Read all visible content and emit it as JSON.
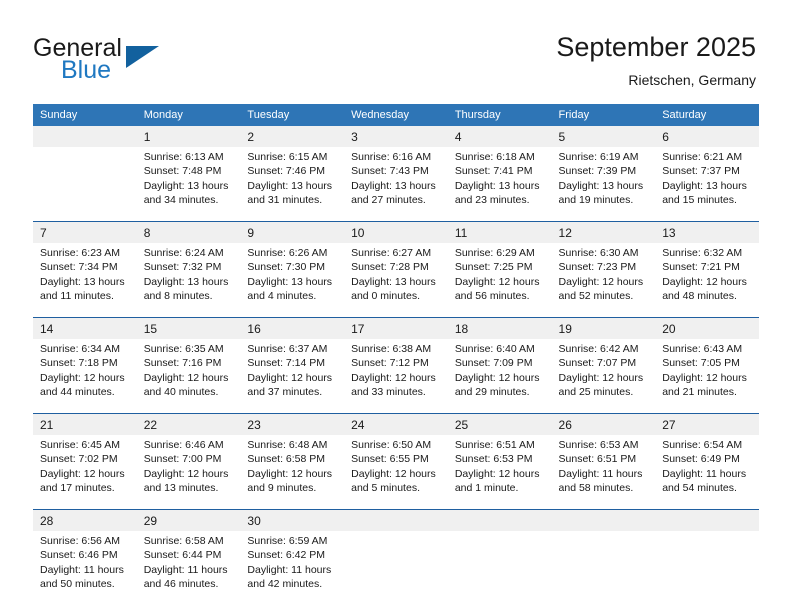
{
  "brand": {
    "word_one": "General",
    "word_two": "Blue",
    "triangle_icon": "triangle-icon",
    "accent_color": "#1f78c1",
    "triangle_color": "#12619e"
  },
  "header": {
    "title": "September 2025",
    "subtitle": "Rietschen, Germany"
  },
  "theme": {
    "header_bg": "#2e75b6",
    "header_text": "#ffffff",
    "daynum_bg": "#f0f0f0",
    "separator": "#1f5fa0"
  },
  "calendar": {
    "weekday_headers": [
      "Sunday",
      "Monday",
      "Tuesday",
      "Wednesday",
      "Thursday",
      "Friday",
      "Saturday"
    ],
    "weeks": [
      {
        "days": [
          {
            "num": "",
            "lines": []
          },
          {
            "num": "1",
            "lines": [
              "Sunrise: 6:13 AM",
              "Sunset: 7:48 PM",
              "Daylight: 13 hours",
              "and 34 minutes."
            ]
          },
          {
            "num": "2",
            "lines": [
              "Sunrise: 6:15 AM",
              "Sunset: 7:46 PM",
              "Daylight: 13 hours",
              "and 31 minutes."
            ]
          },
          {
            "num": "3",
            "lines": [
              "Sunrise: 6:16 AM",
              "Sunset: 7:43 PM",
              "Daylight: 13 hours",
              "and 27 minutes."
            ]
          },
          {
            "num": "4",
            "lines": [
              "Sunrise: 6:18 AM",
              "Sunset: 7:41 PM",
              "Daylight: 13 hours",
              "and 23 minutes."
            ]
          },
          {
            "num": "5",
            "lines": [
              "Sunrise: 6:19 AM",
              "Sunset: 7:39 PM",
              "Daylight: 13 hours",
              "and 19 minutes."
            ]
          },
          {
            "num": "6",
            "lines": [
              "Sunrise: 6:21 AM",
              "Sunset: 7:37 PM",
              "Daylight: 13 hours",
              "and 15 minutes."
            ]
          }
        ]
      },
      {
        "days": [
          {
            "num": "7",
            "lines": [
              "Sunrise: 6:23 AM",
              "Sunset: 7:34 PM",
              "Daylight: 13 hours",
              "and 11 minutes."
            ]
          },
          {
            "num": "8",
            "lines": [
              "Sunrise: 6:24 AM",
              "Sunset: 7:32 PM",
              "Daylight: 13 hours",
              "and 8 minutes."
            ]
          },
          {
            "num": "9",
            "lines": [
              "Sunrise: 6:26 AM",
              "Sunset: 7:30 PM",
              "Daylight: 13 hours",
              "and 4 minutes."
            ]
          },
          {
            "num": "10",
            "lines": [
              "Sunrise: 6:27 AM",
              "Sunset: 7:28 PM",
              "Daylight: 13 hours",
              "and 0 minutes."
            ]
          },
          {
            "num": "11",
            "lines": [
              "Sunrise: 6:29 AM",
              "Sunset: 7:25 PM",
              "Daylight: 12 hours",
              "and 56 minutes."
            ]
          },
          {
            "num": "12",
            "lines": [
              "Sunrise: 6:30 AM",
              "Sunset: 7:23 PM",
              "Daylight: 12 hours",
              "and 52 minutes."
            ]
          },
          {
            "num": "13",
            "lines": [
              "Sunrise: 6:32 AM",
              "Sunset: 7:21 PM",
              "Daylight: 12 hours",
              "and 48 minutes."
            ]
          }
        ]
      },
      {
        "days": [
          {
            "num": "14",
            "lines": [
              "Sunrise: 6:34 AM",
              "Sunset: 7:18 PM",
              "Daylight: 12 hours",
              "and 44 minutes."
            ]
          },
          {
            "num": "15",
            "lines": [
              "Sunrise: 6:35 AM",
              "Sunset: 7:16 PM",
              "Daylight: 12 hours",
              "and 40 minutes."
            ]
          },
          {
            "num": "16",
            "lines": [
              "Sunrise: 6:37 AM",
              "Sunset: 7:14 PM",
              "Daylight: 12 hours",
              "and 37 minutes."
            ]
          },
          {
            "num": "17",
            "lines": [
              "Sunrise: 6:38 AM",
              "Sunset: 7:12 PM",
              "Daylight: 12 hours",
              "and 33 minutes."
            ]
          },
          {
            "num": "18",
            "lines": [
              "Sunrise: 6:40 AM",
              "Sunset: 7:09 PM",
              "Daylight: 12 hours",
              "and 29 minutes."
            ]
          },
          {
            "num": "19",
            "lines": [
              "Sunrise: 6:42 AM",
              "Sunset: 7:07 PM",
              "Daylight: 12 hours",
              "and 25 minutes."
            ]
          },
          {
            "num": "20",
            "lines": [
              "Sunrise: 6:43 AM",
              "Sunset: 7:05 PM",
              "Daylight: 12 hours",
              "and 21 minutes."
            ]
          }
        ]
      },
      {
        "days": [
          {
            "num": "21",
            "lines": [
              "Sunrise: 6:45 AM",
              "Sunset: 7:02 PM",
              "Daylight: 12 hours",
              "and 17 minutes."
            ]
          },
          {
            "num": "22",
            "lines": [
              "Sunrise: 6:46 AM",
              "Sunset: 7:00 PM",
              "Daylight: 12 hours",
              "and 13 minutes."
            ]
          },
          {
            "num": "23",
            "lines": [
              "Sunrise: 6:48 AM",
              "Sunset: 6:58 PM",
              "Daylight: 12 hours",
              "and 9 minutes."
            ]
          },
          {
            "num": "24",
            "lines": [
              "Sunrise: 6:50 AM",
              "Sunset: 6:55 PM",
              "Daylight: 12 hours",
              "and 5 minutes."
            ]
          },
          {
            "num": "25",
            "lines": [
              "Sunrise: 6:51 AM",
              "Sunset: 6:53 PM",
              "Daylight: 12 hours",
              "and 1 minute."
            ]
          },
          {
            "num": "26",
            "lines": [
              "Sunrise: 6:53 AM",
              "Sunset: 6:51 PM",
              "Daylight: 11 hours",
              "and 58 minutes."
            ]
          },
          {
            "num": "27",
            "lines": [
              "Sunrise: 6:54 AM",
              "Sunset: 6:49 PM",
              "Daylight: 11 hours",
              "and 54 minutes."
            ]
          }
        ]
      },
      {
        "days": [
          {
            "num": "28",
            "lines": [
              "Sunrise: 6:56 AM",
              "Sunset: 6:46 PM",
              "Daylight: 11 hours",
              "and 50 minutes."
            ]
          },
          {
            "num": "29",
            "lines": [
              "Sunrise: 6:58 AM",
              "Sunset: 6:44 PM",
              "Daylight: 11 hours",
              "and 46 minutes."
            ]
          },
          {
            "num": "30",
            "lines": [
              "Sunrise: 6:59 AM",
              "Sunset: 6:42 PM",
              "Daylight: 11 hours",
              "and 42 minutes."
            ]
          },
          {
            "num": "",
            "lines": []
          },
          {
            "num": "",
            "lines": []
          },
          {
            "num": "",
            "lines": []
          },
          {
            "num": "",
            "lines": []
          }
        ]
      }
    ]
  }
}
